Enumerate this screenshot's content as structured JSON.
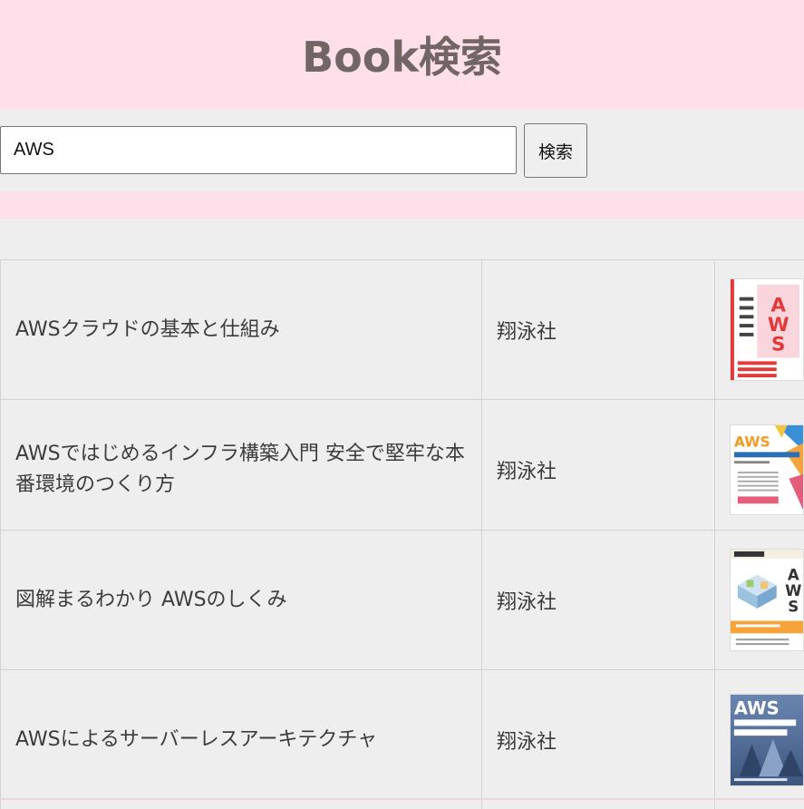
{
  "header": {
    "title": "Book検索"
  },
  "search": {
    "value": "AWS",
    "button_label": "検索"
  },
  "results": [
    {
      "title": "AWSクラウドの基本と仕組み",
      "publisher": "翔泳社",
      "cover_icon": "book-cover-aws-cloud-basics"
    },
    {
      "title": "AWSではじめるインフラ構築入門 安全で堅牢な本番環境のつくり方",
      "publisher": "翔泳社",
      "cover_icon": "book-cover-aws-infra-intro"
    },
    {
      "title": "図解まるわかり AWSのしくみ",
      "publisher": "翔泳社",
      "cover_icon": "book-cover-aws-zukai"
    },
    {
      "title": "AWSによるサーバーレスアーキテクチャ",
      "publisher": "翔泳社",
      "cover_icon": "book-cover-aws-serverless"
    }
  ]
}
